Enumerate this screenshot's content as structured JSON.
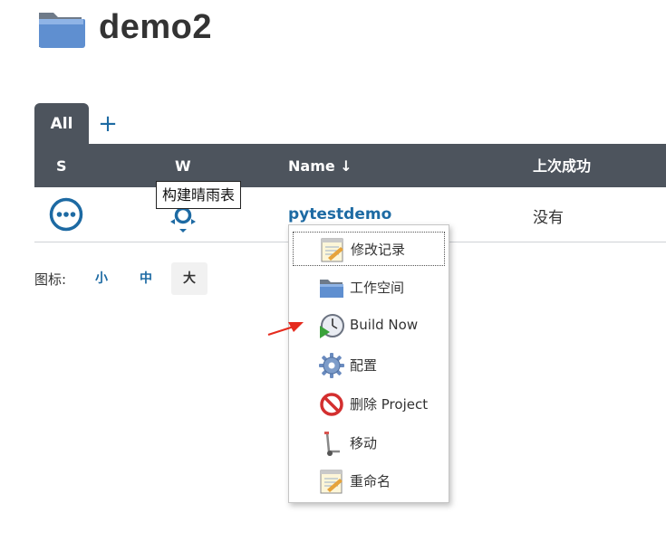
{
  "header": {
    "title": "demo2"
  },
  "tabs": {
    "all_label": "All",
    "add_label": "+"
  },
  "table": {
    "columns": [
      "S",
      "W",
      "Name ↓",
      "上次成功"
    ],
    "rows": [
      {
        "name": "pytestdemo",
        "last_success": "没有"
      }
    ]
  },
  "tooltip": {
    "text": "构建晴雨表"
  },
  "icon_size": {
    "label": "图标:",
    "options": [
      "小",
      "中",
      "大"
    ],
    "selected": "大"
  },
  "context_menu": {
    "items": [
      {
        "label": "修改记录",
        "icon": "notepad-icon"
      },
      {
        "label": "工作空间",
        "icon": "folder-icon"
      },
      {
        "label": "Build Now",
        "icon": "clock-play-icon"
      },
      {
        "label": "配置",
        "icon": "gear-icon"
      },
      {
        "label": "删除 Project",
        "icon": "no-entry-icon"
      },
      {
        "label": "移动",
        "icon": "hand-truck-icon"
      },
      {
        "label": "重命名",
        "icon": "notepad-icon"
      }
    ]
  },
  "colors": {
    "header_bg": "#4d545d",
    "link": "#1d6aa3",
    "arrow": "#e52b1e"
  }
}
